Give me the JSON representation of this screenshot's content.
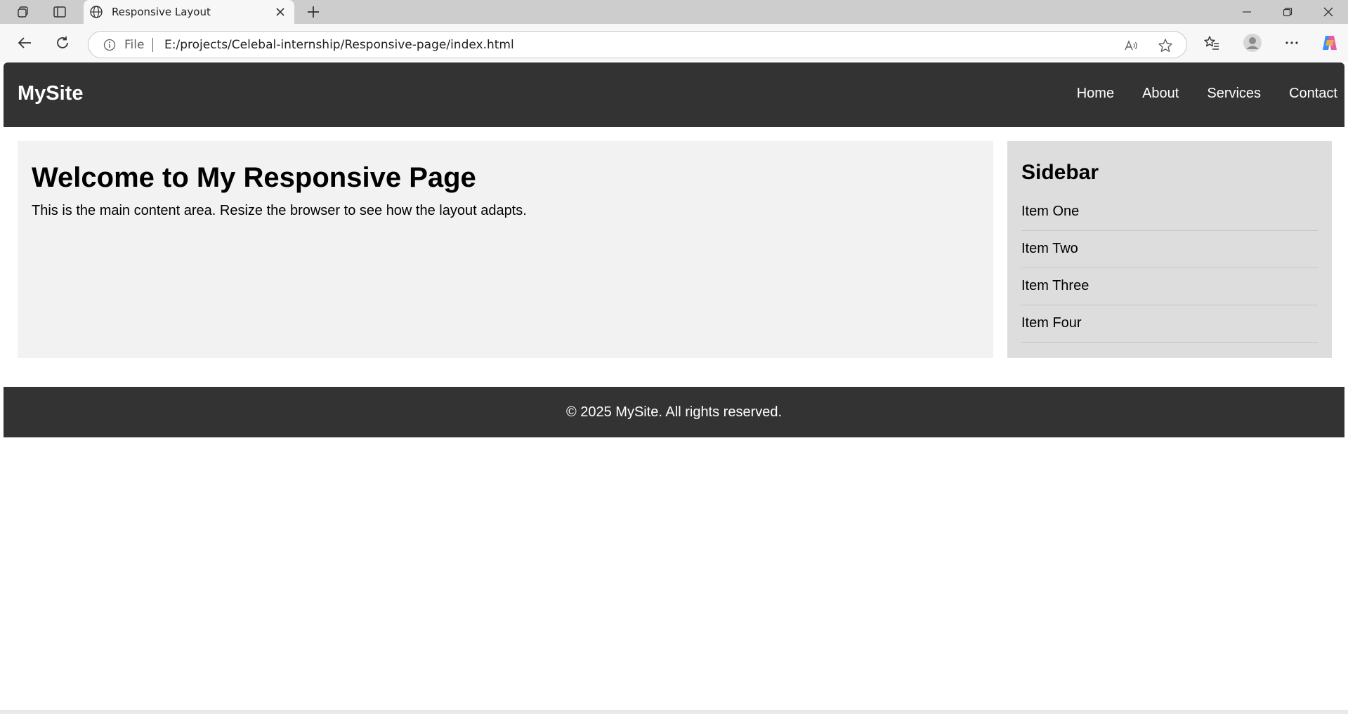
{
  "browser": {
    "tab_title": "Responsive Layout",
    "address_prefix": "File",
    "url": "E:/projects/Celebal-internship/Responsive-page/index.html",
    "icons": [
      "workspaces-icon",
      "tab-actions-icon",
      "globe-icon",
      "close-icon",
      "plus-icon",
      "minimize-icon",
      "restore-icon",
      "window-close-icon",
      "back-icon",
      "refresh-icon",
      "info-icon",
      "read-aloud-icon",
      "favorite-star-icon",
      "favorites-icon",
      "profile-avatar-icon",
      "more-icon",
      "copilot-icon"
    ]
  },
  "site": {
    "logo": "MySite",
    "nav": [
      "Home",
      "About",
      "Services",
      "Contact"
    ]
  },
  "main": {
    "title": "Welcome to My Responsive Page",
    "text": "This is the main content area. Resize the browser to see how the layout adapts."
  },
  "sidebar": {
    "title": "Sidebar",
    "items": [
      "Item One",
      "Item Two",
      "Item Three",
      "Item Four"
    ]
  },
  "footer": {
    "text": "© 2025 MySite. All rights reserved."
  },
  "colors": {
    "header_bg": "#333333",
    "main_bg": "#f2f2f2",
    "sidebar_bg": "#dddddd"
  }
}
